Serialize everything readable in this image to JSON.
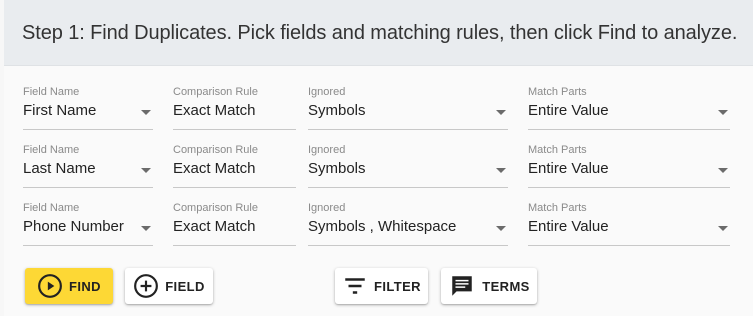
{
  "header": {
    "title": "Step 1: Find Duplicates. Pick fields and matching rules, then click Find to analyze."
  },
  "labels": {
    "field_name": "Field Name",
    "comparison_rule": "Comparison Rule",
    "ignored": "Ignored",
    "match_parts": "Match Parts"
  },
  "rows": [
    {
      "field_name": "First Name",
      "comparison_rule": "Exact Match",
      "ignored": "Symbols",
      "match_parts": "Entire Value"
    },
    {
      "field_name": "Last Name",
      "comparison_rule": "Exact Match",
      "ignored": "Symbols",
      "match_parts": "Entire Value"
    },
    {
      "field_name": "Phone Number",
      "comparison_rule": "Exact Match",
      "ignored": "Symbols , Whitespace",
      "match_parts": "Entire Value"
    }
  ],
  "buttons": {
    "find": "FIND",
    "field": "FIELD",
    "filter": "FILTER",
    "terms": "TERMS"
  },
  "icons": {
    "find": "play-circle-outline-icon",
    "field": "add-circle-outline-icon",
    "filter": "filter-list-icon",
    "terms": "comment-icon",
    "dropdown": "arrow-drop-down-icon"
  },
  "colors": {
    "find_button": "#fdd835",
    "header_background": "#e9ecef"
  }
}
